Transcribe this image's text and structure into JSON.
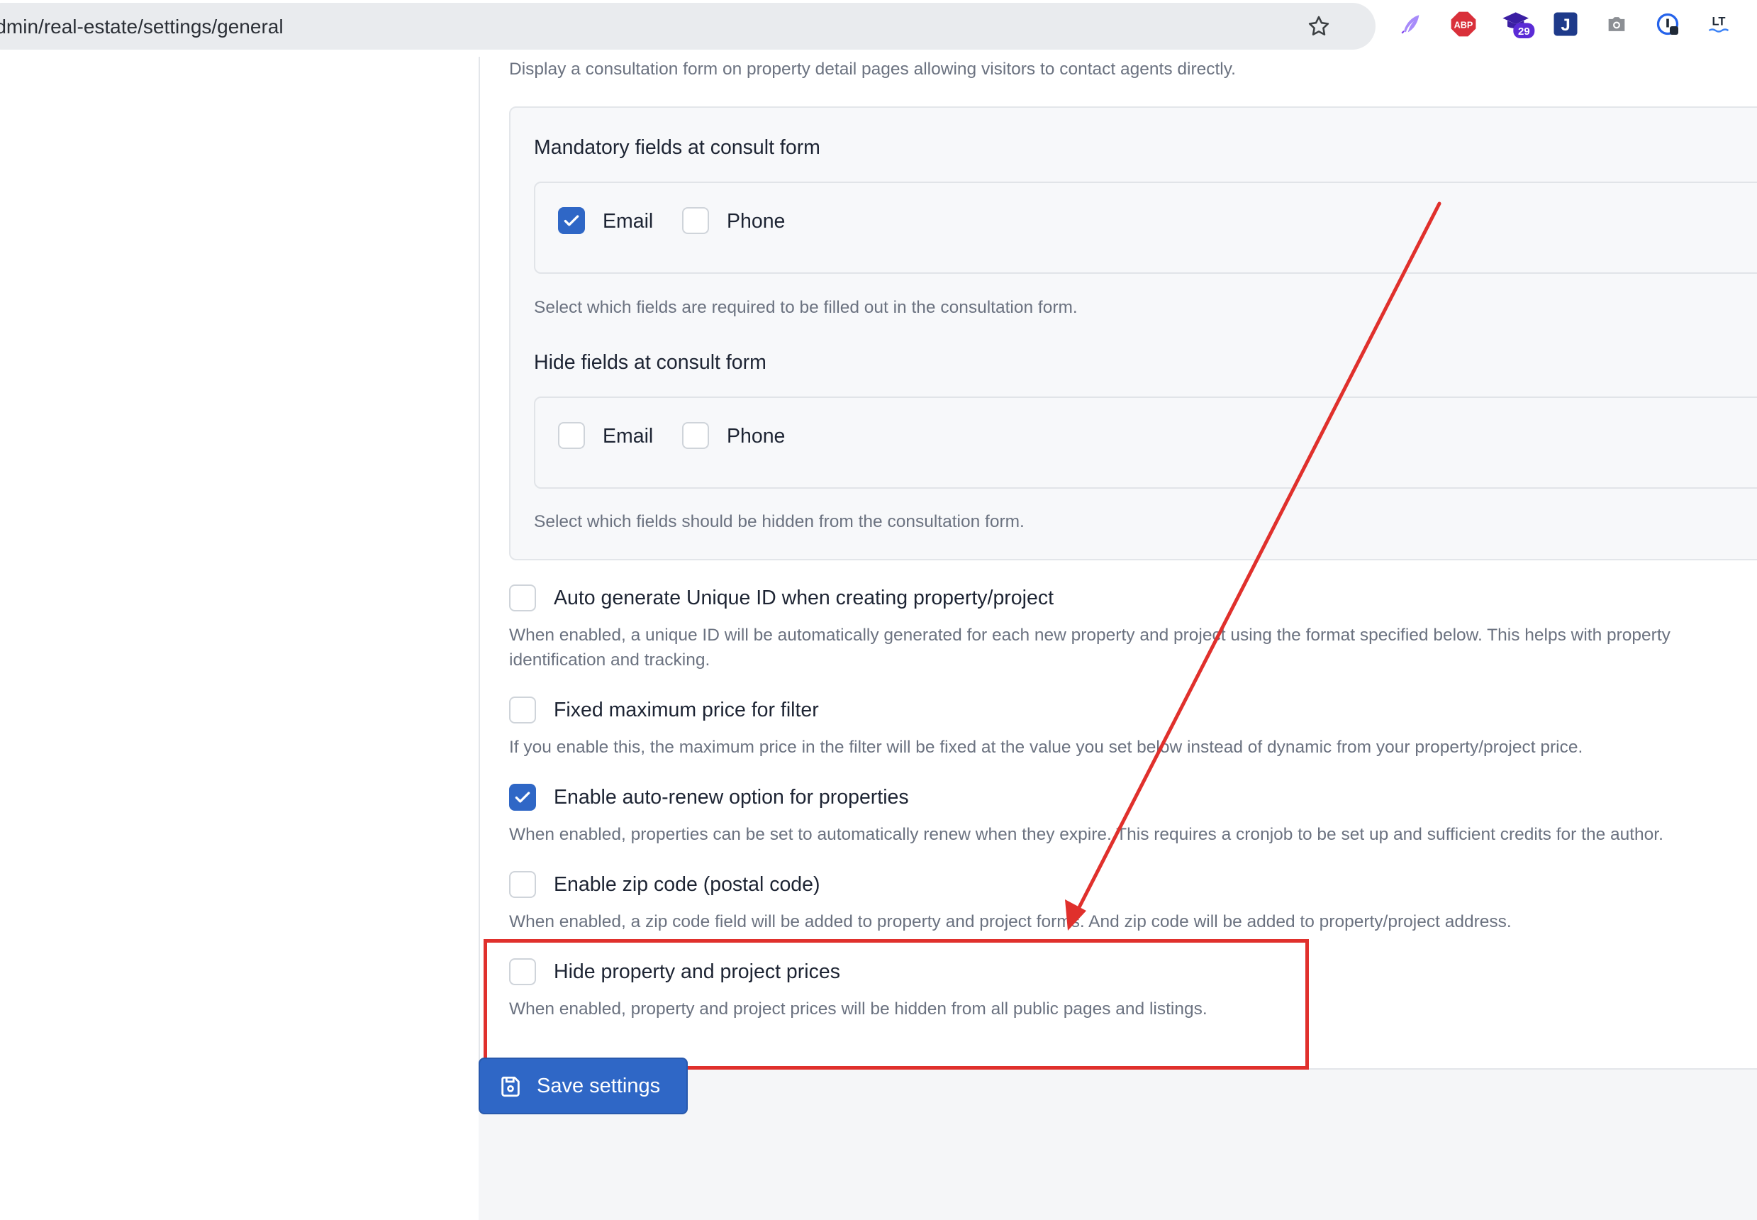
{
  "browser": {
    "url": "/admin/real-estate/settings/general",
    "bookmark_icon": "star-icon",
    "extensions": [
      {
        "name": "quill-extension-icon",
        "color": "#8a5cf6"
      },
      {
        "name": "adblock-plus-icon",
        "label": "ABP",
        "color": "#d9303a"
      },
      {
        "name": "graduation-cap-badge-icon",
        "badge": "29",
        "color": "#5b2bd6"
      },
      {
        "name": "j-extension-icon",
        "label": "J",
        "color": "#1e3a8a"
      },
      {
        "name": "camera-icon",
        "color": "#8c8f94"
      },
      {
        "name": "password-manager-icon",
        "color": "#2563eb"
      },
      {
        "name": "languagetool-icon",
        "label": "LT",
        "color": "#1f2937"
      }
    ]
  },
  "consult": {
    "description": "Display a consultation form on property detail pages allowing visitors to contact agents directly.",
    "mandatory": {
      "title": "Mandatory fields at consult form",
      "options": [
        {
          "label": "Email",
          "checked": true
        },
        {
          "label": "Phone",
          "checked": false
        }
      ],
      "help": "Select which fields are required to be filled out in the consultation form."
    },
    "hidden": {
      "title": "Hide fields at consult form",
      "options": [
        {
          "label": "Email",
          "checked": false
        },
        {
          "label": "Phone",
          "checked": false
        }
      ],
      "help": "Select which fields should be hidden from the consultation form."
    }
  },
  "settings": [
    {
      "label": "Auto generate Unique ID when creating property/project",
      "checked": false,
      "help_line1": "When enabled, a unique ID will be automatically generated for each new property and project using the format specified below. This helps with property",
      "help_line2": "identification and tracking."
    },
    {
      "label": "Fixed maximum price for filter",
      "checked": false,
      "help_line1": "If you enable this, the maximum price in the filter will be fixed at the value you set below instead of dynamic from your property/project price."
    },
    {
      "label": "Enable auto-renew option for properties",
      "checked": true,
      "help_line1": "When enabled, properties can be set to automatically renew when they expire. This requires a cronjob to be set up and sufficient credits for the author."
    },
    {
      "label": "Enable zip code (postal code)",
      "checked": false,
      "help_line1": "When enabled, a zip code field will be added to property and project forms. And zip code will be added to property/project address."
    },
    {
      "label": "Hide property and project prices",
      "checked": false,
      "help_line1": "When enabled, property and project prices will be hidden from all public pages and listings."
    }
  ],
  "actions": {
    "save_label": "Save settings"
  },
  "annotation": {
    "highlight_color": "#e0302c"
  }
}
